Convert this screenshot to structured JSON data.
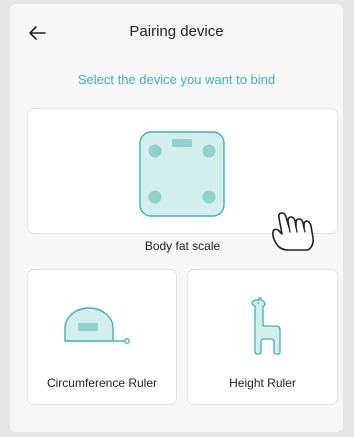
{
  "header": {
    "title": "Pairing device",
    "back_icon": "arrow-left-icon"
  },
  "subtitle": "Select the device you want to bind",
  "devices": [
    {
      "label": "Body fat scale",
      "icon": "body-fat-scale-icon"
    },
    {
      "label": "Circumference Ruler",
      "icon": "tape-measure-icon"
    },
    {
      "label": "Height Ruler",
      "icon": "giraffe-height-ruler-icon"
    }
  ],
  "pointer_icon": "pointing-hand-icon",
  "colors": {
    "accent": "#3ab7ad",
    "icon_fill": "#d2efee",
    "icon_stroke": "#3fb3ac",
    "icon_dot": "#8fd3cf"
  }
}
